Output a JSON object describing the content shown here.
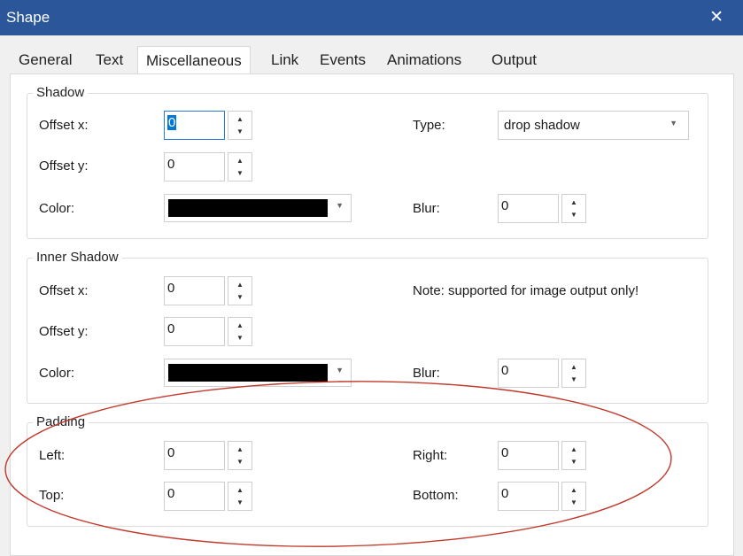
{
  "window": {
    "title": "Shape",
    "close_glyph": "✕"
  },
  "tabs": [
    {
      "label": "General"
    },
    {
      "label": "Text"
    },
    {
      "label": "Miscellaneous",
      "active": true
    },
    {
      "label": "Link"
    },
    {
      "label": "Events"
    },
    {
      "label": "Animations"
    },
    {
      "label": "Output"
    }
  ],
  "shadow": {
    "title": "Shadow",
    "offset_x_label": "Offset x:",
    "offset_x_value": "0",
    "offset_y_label": "Offset y:",
    "offset_y_value": "0",
    "color_label": "Color:",
    "color_value": "#000000",
    "type_label": "Type:",
    "type_value": "drop shadow",
    "blur_label": "Blur:",
    "blur_value": "0"
  },
  "inner_shadow": {
    "title": "Inner Shadow",
    "offset_x_label": "Offset x:",
    "offset_x_value": "0",
    "offset_y_label": "Offset y:",
    "offset_y_value": "0",
    "color_label": "Color:",
    "color_value": "#000000",
    "note": "Note: supported for image output only!",
    "blur_label": "Blur:",
    "blur_value": "0"
  },
  "padding": {
    "title": "Padding",
    "left_label": "Left:",
    "left_value": "0",
    "top_label": "Top:",
    "top_value": "0",
    "right_label": "Right:",
    "right_value": "0",
    "bottom_label": "Bottom:",
    "bottom_value": "0"
  },
  "glyphs": {
    "spin_up": "▲",
    "spin_down": "▼",
    "dropdown": "▼"
  },
  "colors": {
    "titlebar": "#2b579a",
    "selection": "#0078d7",
    "annotation": "#c0392b"
  }
}
